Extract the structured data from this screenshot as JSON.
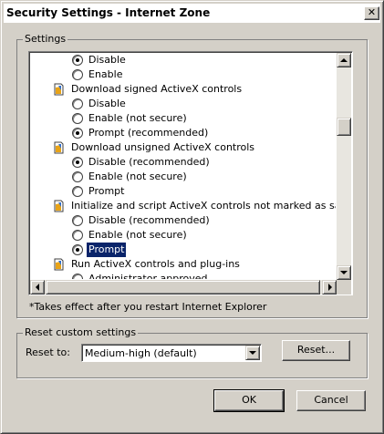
{
  "window": {
    "title": "Security Settings - Internet Zone",
    "close_glyph": "✕"
  },
  "settings": {
    "group_label": "Settings",
    "rows": [
      {
        "kind": "radio",
        "label": "Disable",
        "checked": true
      },
      {
        "kind": "radio",
        "label": "Enable",
        "checked": false
      },
      {
        "kind": "category",
        "label": "Download signed ActiveX controls",
        "icon": "activex-setting-icon"
      },
      {
        "kind": "radio",
        "label": "Disable",
        "checked": false
      },
      {
        "kind": "radio",
        "label": "Enable (not secure)",
        "checked": false
      },
      {
        "kind": "radio",
        "label": "Prompt (recommended)",
        "checked": true
      },
      {
        "kind": "category",
        "label": "Download unsigned ActiveX controls",
        "icon": "activex-setting-icon"
      },
      {
        "kind": "radio",
        "label": "Disable (recommended)",
        "checked": true
      },
      {
        "kind": "radio",
        "label": "Enable (not secure)",
        "checked": false
      },
      {
        "kind": "radio",
        "label": "Prompt",
        "checked": false
      },
      {
        "kind": "category",
        "label": "Initialize and script ActiveX controls not marked as safe for sc",
        "icon": "activex-setting-icon"
      },
      {
        "kind": "radio",
        "label": "Disable (recommended)",
        "checked": false
      },
      {
        "kind": "radio",
        "label": "Enable (not secure)",
        "checked": false
      },
      {
        "kind": "radio",
        "label": "Prompt",
        "checked": true,
        "selected": true
      },
      {
        "kind": "category",
        "label": "Run ActiveX controls and plug-ins",
        "icon": "activex-setting-icon"
      },
      {
        "kind": "radio",
        "label": "Administrator approved",
        "checked": false
      }
    ],
    "vertical_scroll_position": 0.28,
    "note": "*Takes effect after you restart Internet Explorer"
  },
  "reset": {
    "group_label": "Reset custom settings",
    "reset_to_label": "Reset to:",
    "selected_level": "Medium-high (default)",
    "reset_button": "Reset..."
  },
  "buttons": {
    "ok": "OK",
    "cancel": "Cancel"
  },
  "colors": {
    "face": "#d4d0c8",
    "selection": "#0a246a",
    "icon_gold": "#e8a317"
  }
}
